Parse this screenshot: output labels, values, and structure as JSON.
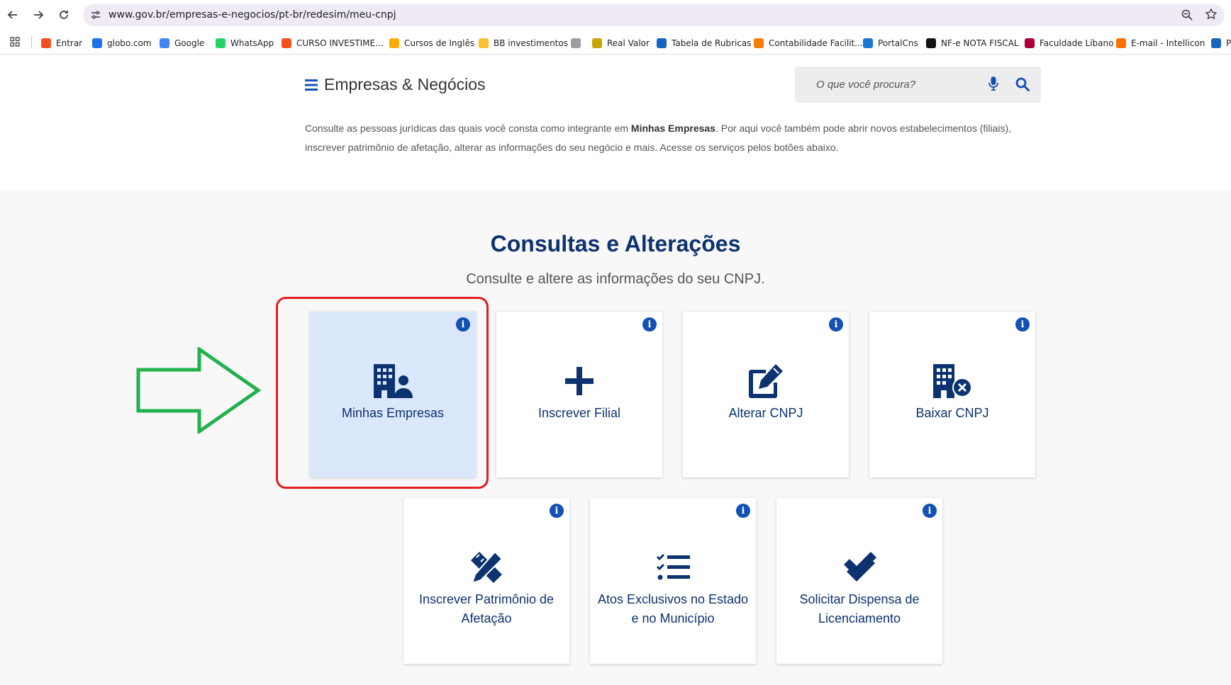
{
  "browser": {
    "url": "www.gov.br/empresas-e-negocios/pt-br/redesim/meu-cnpj",
    "bookmarks": [
      {
        "label": "Entrar",
        "color": "#f25022"
      },
      {
        "label": "globo.com",
        "color": "#1a73e8"
      },
      {
        "label": "Google",
        "color": "#4285f4"
      },
      {
        "label": "WhatsApp",
        "color": "#25d366"
      },
      {
        "label": "CURSO INVESTIME...",
        "color": "#f4511e"
      },
      {
        "label": "Cursos de Inglês",
        "color": "#f9ab00"
      },
      {
        "label": "BB investimentos",
        "color": "#fbc02d"
      },
      {
        "label": "",
        "color": "#9e9e9e"
      },
      {
        "label": "Real Valor",
        "color": "#c9a400"
      },
      {
        "label": "Tabela de Rubricas",
        "color": "#1565c0"
      },
      {
        "label": "Contabilidade Facilit...",
        "color": "#f57c00"
      },
      {
        "label": "PortalCns",
        "color": "#1976d2"
      },
      {
        "label": "NF-e NOTA FISCAL",
        "color": "#111111"
      },
      {
        "label": "Faculdade Líbano",
        "color": "#b0003a"
      },
      {
        "label": "E-mail - Intellicon",
        "color": "#ff6f00"
      },
      {
        "label": "Po",
        "color": "#1565c0"
      }
    ]
  },
  "header": {
    "title": "Empresas & Negócios",
    "search_placeholder": "O que você procura?"
  },
  "intro": {
    "text_before": "Consulte as pessoas jurídicas das quais você consta como integrante em ",
    "bold": "Minhas Empresas",
    "text_after": ". Por aqui você também pode abrir novos estabelecimentos (filiais), inscrever patrimônio de afetação, alterar as informações do seu negócio e mais. Acesse os serviços pelos botões abaixo."
  },
  "section": {
    "title": "Consultas e Alterações",
    "subtitle": "Consulte e altere as informações do seu CNPJ."
  },
  "cards": [
    {
      "label": "Minhas Empresas",
      "icon": "building-user-icon",
      "active": true
    },
    {
      "label": "Inscrever Filial",
      "icon": "plus-icon",
      "active": false
    },
    {
      "label": "Alterar CNPJ",
      "icon": "edit-icon",
      "active": false
    },
    {
      "label": "Baixar CNPJ",
      "icon": "building-x-icon",
      "active": false
    },
    {
      "label": "Inscrever Patrimônio de Afetação",
      "icon": "pencil-ruler-icon",
      "active": false
    },
    {
      "label": "Atos Exclusivos no Estado e no Município",
      "icon": "checklist-icon",
      "active": false
    },
    {
      "label": "Solicitar Dispensa de Licenciamento",
      "icon": "double-check-icon",
      "active": false
    }
  ],
  "colors": {
    "primary": "#0c326f",
    "accent": "#1351b4",
    "active_card": "#dbe8fb",
    "annotation_red": "#e11d21",
    "annotation_green": "#22b14c"
  }
}
